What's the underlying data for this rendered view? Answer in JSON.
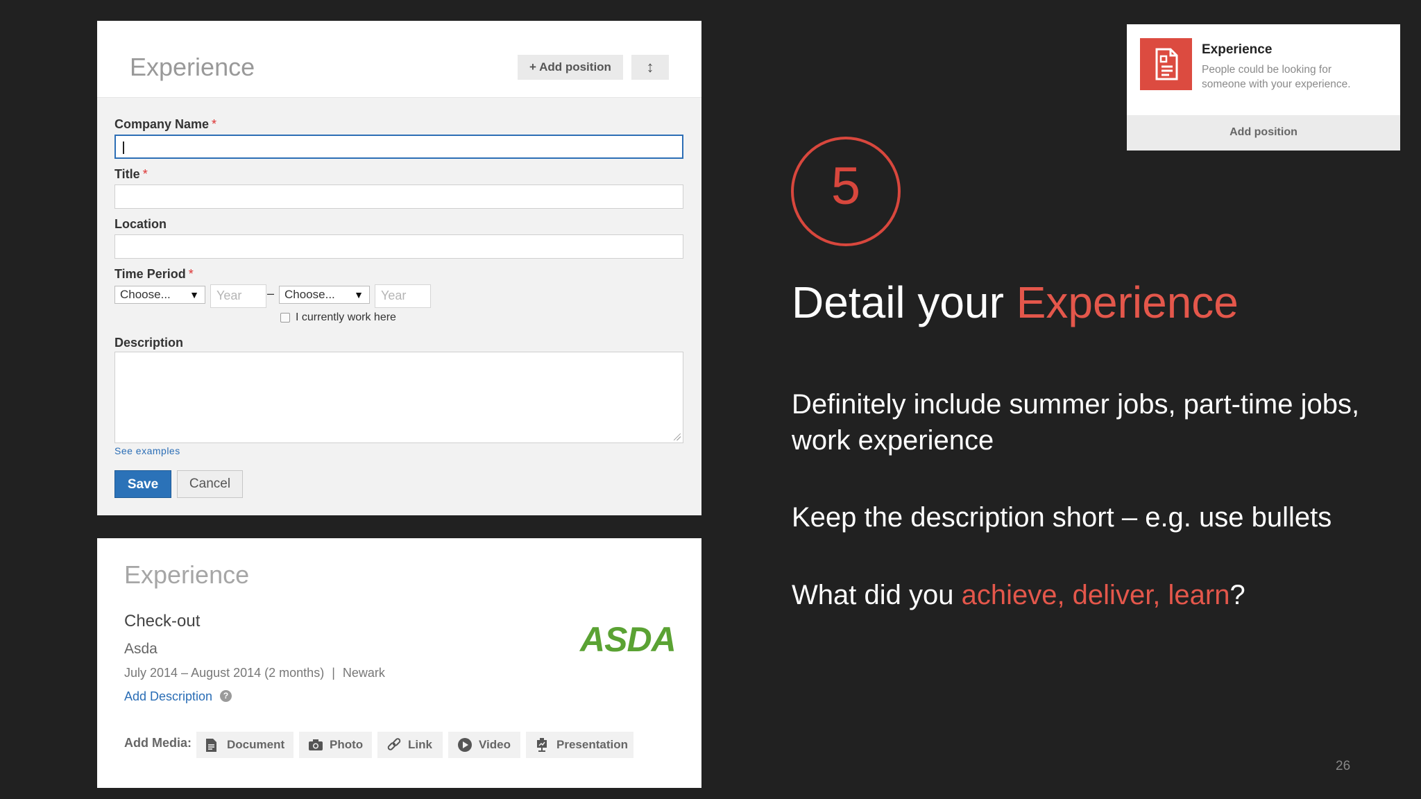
{
  "form": {
    "title": "Experience",
    "add_position": "+ Add position",
    "reorder_icon": "↕",
    "company_label": "Company Name",
    "title_label": "Title",
    "location_label": "Location",
    "time_period_label": "Time Period",
    "required_marker": "*",
    "start_month": "Choose...",
    "start_year_placeholder": "Year",
    "dash": "–",
    "end_month": "Choose...",
    "end_year_placeholder": "Year",
    "current_label": "I currently work here",
    "description_label": "Description",
    "see_examples": "See examples",
    "save": "Save",
    "cancel": "Cancel"
  },
  "profile": {
    "title": "Experience",
    "job_title": "Check-out",
    "company": "Asda",
    "dates": "July 2014 – August 2014 (2 months)",
    "separator": "|",
    "location": "Newark",
    "add_description": "Add Description",
    "help_icon": "?",
    "logo_text": "ASDA",
    "add_media_label": "Add Media:",
    "media_buttons": [
      "Document",
      "Photo",
      "Link",
      "Video",
      "Presentation"
    ]
  },
  "card": {
    "title": "Experience",
    "description": "People could be looking for someone with your experience.",
    "add_position": "Add position"
  },
  "slide": {
    "step": "5",
    "headline_plain": "Detail your ",
    "headline_accent": "Experience",
    "bullet1": "Definitely include summer jobs, part-time jobs, work experience",
    "bullet2": "Keep the description short – e.g. use bullets",
    "bullet3_plain": "What did you ",
    "bullet3_accent": "achieve, deliver, learn",
    "bullet3_end": "?",
    "page_number": "26"
  },
  "colors": {
    "background": "#212121",
    "accent_red": "#e4574b",
    "linkedin_blue": "#2b72b8",
    "asda_green": "#5aa233"
  }
}
